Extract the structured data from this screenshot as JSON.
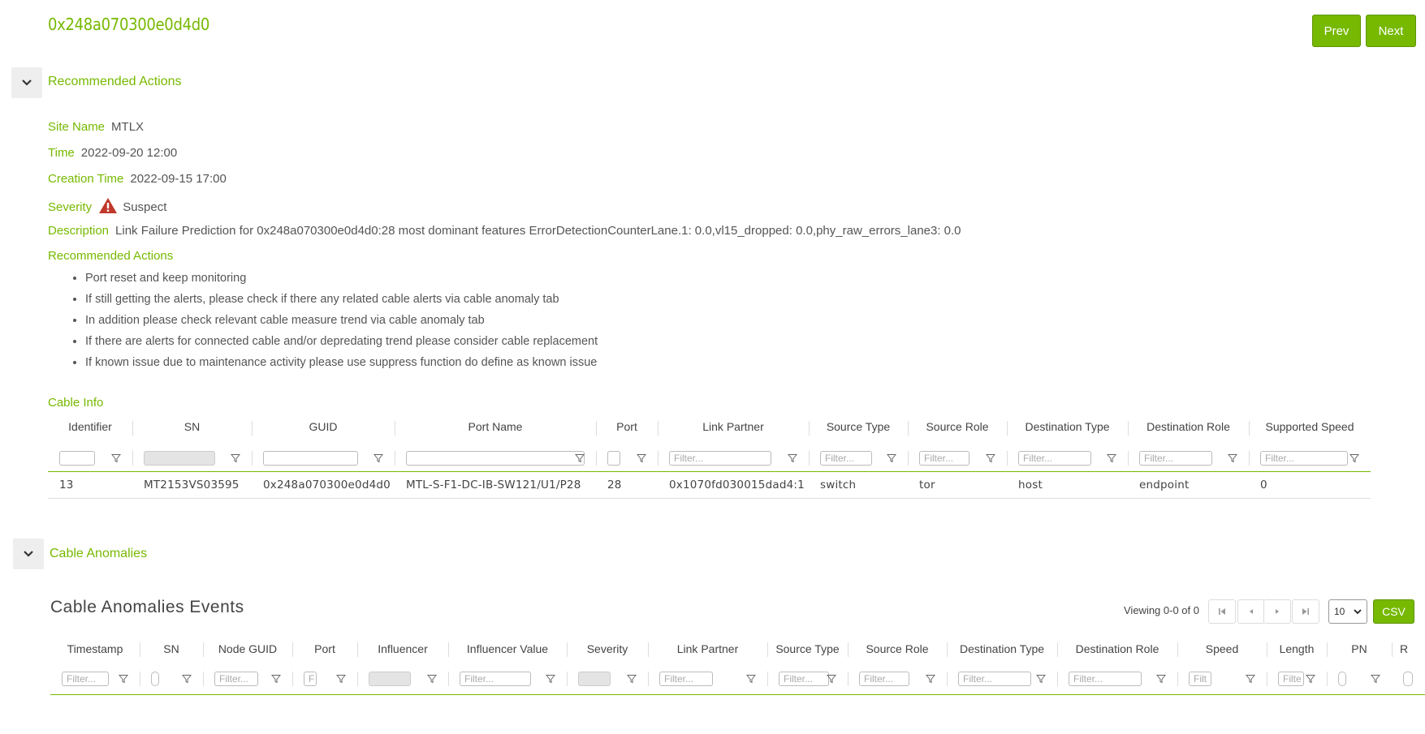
{
  "header": {
    "title": "0x248a070300e0d4d0",
    "prev_label": "Prev",
    "next_label": "Next"
  },
  "recommended_section": {
    "title": "Recommended Actions",
    "fields": {
      "site_name_label": "Site Name",
      "site_name_value": "MTLX",
      "time_label": "Time",
      "time_value": "2022-09-20 12:00",
      "creation_time_label": "Creation Time",
      "creation_time_value": "2022-09-15 17:00",
      "severity_label": "Severity",
      "severity_value": "Suspect",
      "description_label": "Description",
      "description_value": "Link Failure Prediction for 0x248a070300e0d4d0:28 most dominant features ErrorDetectionCounterLane.1: 0.0,vl15_dropped: 0.0,phy_raw_errors_lane3: 0.0",
      "actions_label": "Recommended Actions"
    },
    "actions": [
      "Port reset and keep monitoring",
      "If still getting the alerts, please check if there any related cable alerts via cable anomaly tab",
      "In addition please check relevant cable measure trend via cable anomaly tab",
      "If there are alerts for connected cable and/or depredating trend please consider cable replacement",
      "If known issue due to maintenance activity please use suppress function do define as known issue"
    ]
  },
  "cable_info": {
    "title": "Cable Info",
    "columns": [
      "Identifier",
      "SN",
      "GUID",
      "Port Name",
      "Port",
      "Link Partner",
      "Source Type",
      "Source Role",
      "Destination Type",
      "Destination Role",
      "Supported Speed"
    ],
    "filter_placeholder": "Filter...",
    "row": [
      "13",
      "MT2153VS03595",
      "0x248a070300e0d4d0",
      "MTL-S-F1-DC-IB-SW121/U1/P28",
      "28",
      "0x1070fd030015dad4:1",
      "switch",
      "tor",
      "host",
      "endpoint",
      "0"
    ]
  },
  "cable_anomalies": {
    "section_title": "Cable Anomalies",
    "events_title": "Cable Anomalies Events",
    "viewing_text": "Viewing 0-0 of 0",
    "page_size": "10",
    "csv_label": "CSV",
    "columns": [
      "Timestamp",
      "SN",
      "Node GUID",
      "Port",
      "Influencer",
      "Influencer Value",
      "Severity",
      "Link Partner",
      "Source Type",
      "Source Role",
      "Destination Type",
      "Destination Role",
      "Speed",
      "Length",
      "PN",
      "R"
    ],
    "filter_placeholder": "Filter...",
    "filter_short_port": "F",
    "filter_short_speed": "Filt",
    "filter_short_length": "Filte"
  },
  "colors": {
    "accent": "#76b900",
    "warning": "#c0392b"
  }
}
